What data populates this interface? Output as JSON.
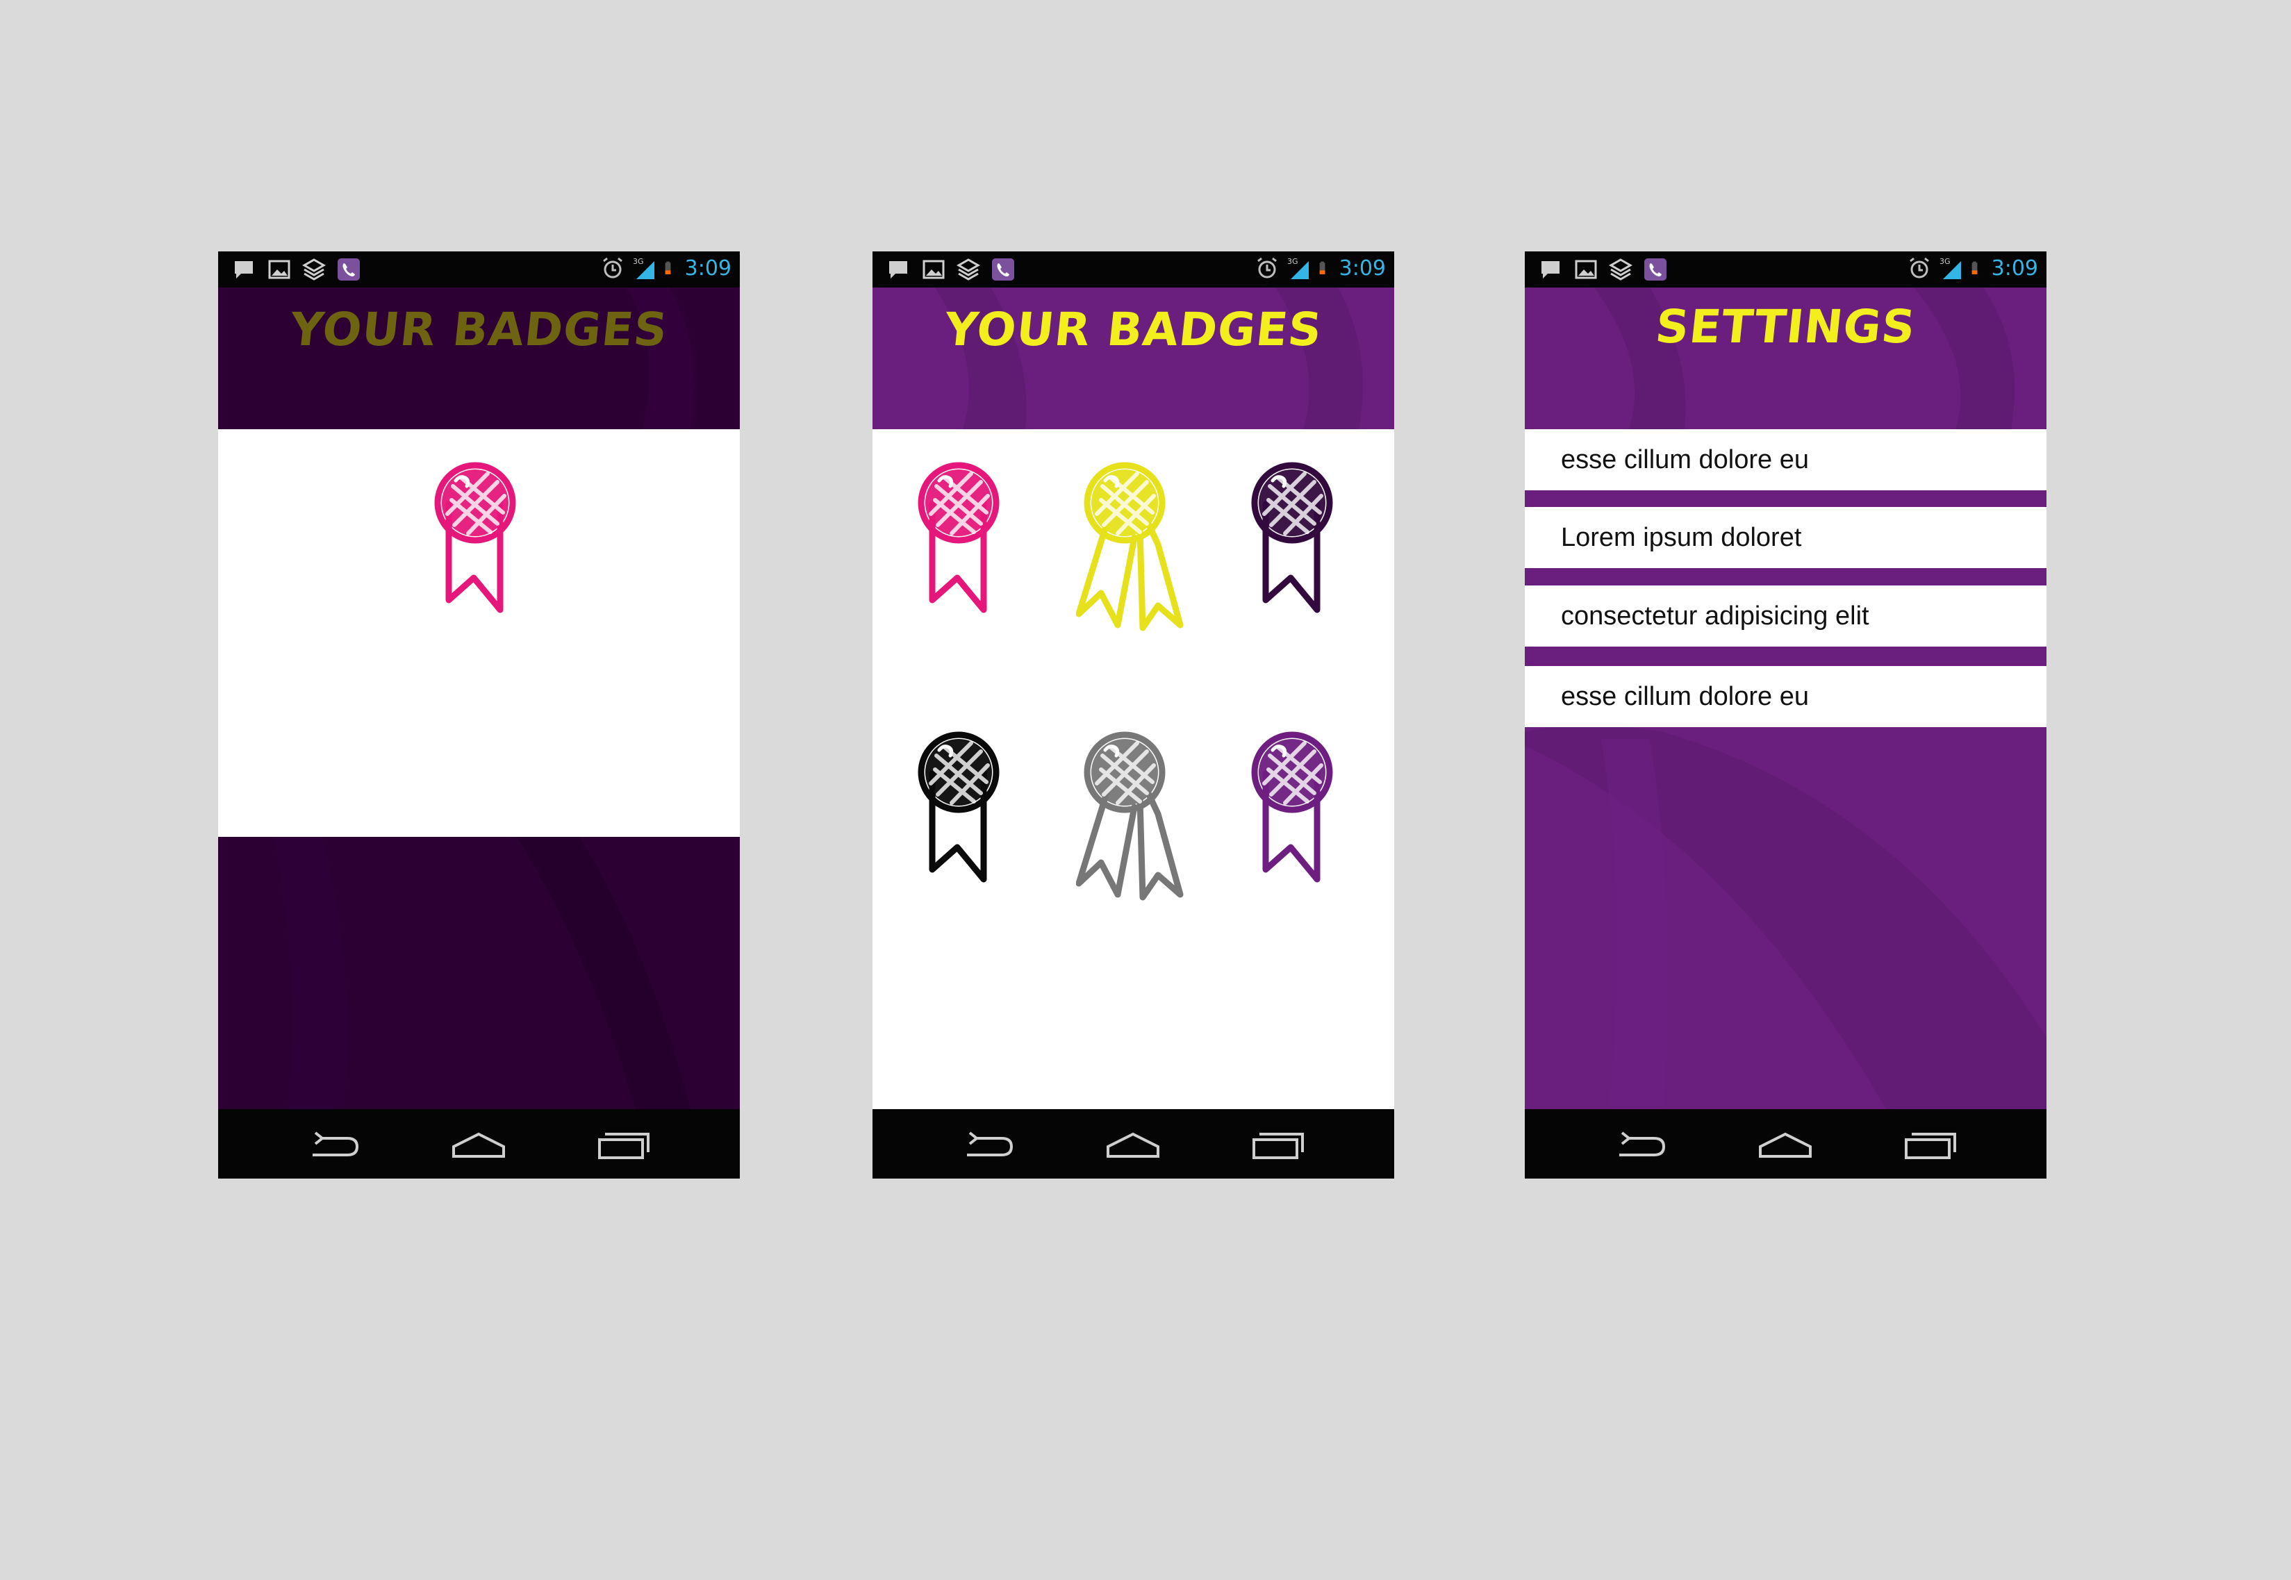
{
  "colors": {
    "page_bg": "#dadada",
    "dark_purple": "#2c0033",
    "purple": "#6a1e7e",
    "yellow": "#f3ee1d",
    "olive_title": "#6d6310",
    "pink": "#e5177a",
    "status_time": "#33b5e5"
  },
  "status": {
    "time": "3:09",
    "network": "3G"
  },
  "screens": [
    {
      "title": "YOUR BADGES",
      "badges": [
        {
          "icon": "ribbon-badge-icon",
          "color": "#e5177a"
        }
      ]
    },
    {
      "title": "YOUR BADGES",
      "badges": [
        {
          "icon": "ribbon-badge-icon",
          "color": "#e5177a"
        },
        {
          "icon": "double-ribbon-badge-icon",
          "color": "#e6e11a"
        },
        {
          "icon": "ribbon-badge-icon",
          "color": "#330a3e"
        },
        {
          "icon": "ribbon-badge-icon",
          "color": "#0a0a0a"
        },
        {
          "icon": "double-ribbon-badge-icon",
          "color": "#777777"
        },
        {
          "icon": "ribbon-badge-icon",
          "color": "#6e1e80"
        }
      ]
    },
    {
      "title": "SETTINGS",
      "items": [
        {
          "label": "esse cillum dolore eu"
        },
        {
          "label": "Lorem ipsum doloret"
        },
        {
          "label": "consectetur adipisicing elit"
        },
        {
          "label": "esse cillum dolore eu"
        }
      ]
    }
  ],
  "nav": {
    "icons": [
      "back-icon",
      "home-icon",
      "recent-apps-icon"
    ]
  }
}
